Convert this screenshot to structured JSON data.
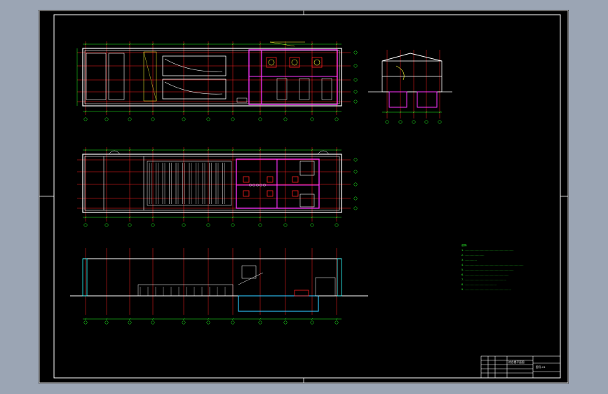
{
  "drawing": {
    "colors": {
      "background": "#000000",
      "frame": "#ffffff",
      "wall": "#ffffff",
      "axis": "#ff2020",
      "dimension": "#22ff22",
      "equipment": "#ff33ff",
      "water": "#30c8ff",
      "glass": "#30ffff",
      "annotation": "#ffff33"
    },
    "views": [
      {
        "name": "upper-floor-plan"
      },
      {
        "name": "cross-section"
      },
      {
        "name": "ground-floor-plan"
      },
      {
        "name": "longitudinal-section"
      }
    ],
    "notes": {
      "title": "说明:",
      "lines": [
        "1. ……………………………………………………",
        "2. ……………………",
        "3. ……………",
        "4. ………………………………………………………………",
        "5. ……………………………………………………",
        "6. ………………………………………………",
        "7. ……………………………………………",
        "8. …………………………………",
        "9. …………………………………………………"
      ]
    },
    "title_block": {
      "drawing_title": "综合楼平面图",
      "drawing_number": "图号-01"
    }
  }
}
